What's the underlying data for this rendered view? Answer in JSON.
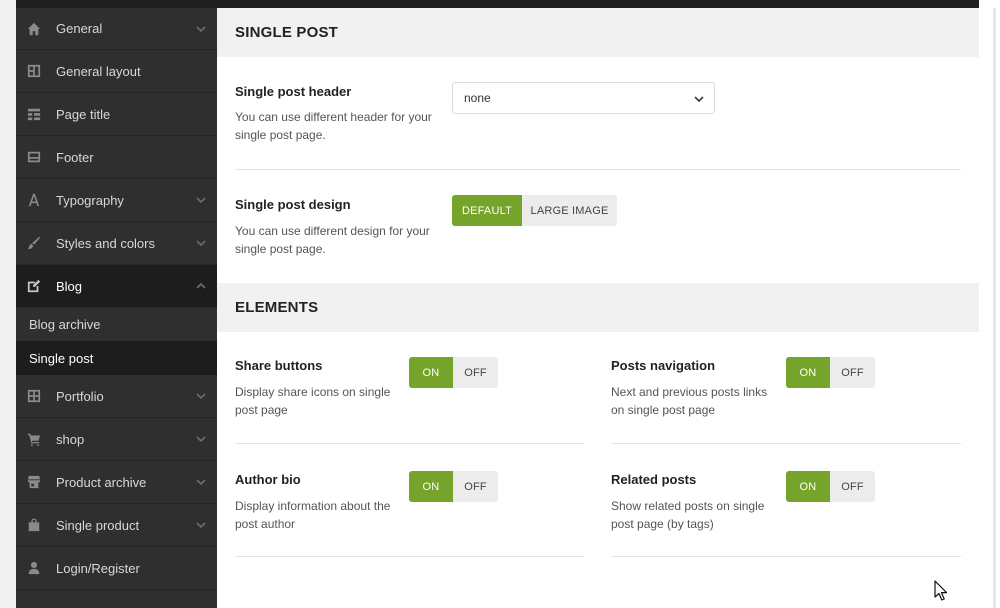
{
  "sidebar": {
    "items": [
      {
        "label": "General",
        "icon": "home-icon",
        "chevron": "down"
      },
      {
        "label": "General layout",
        "icon": "layout-icon",
        "chevron": ""
      },
      {
        "label": "Page title",
        "icon": "page-title-icon",
        "chevron": ""
      },
      {
        "label": "Footer",
        "icon": "footer-icon",
        "chevron": ""
      },
      {
        "label": "Typography",
        "icon": "typography-icon",
        "chevron": "down"
      },
      {
        "label": "Styles and colors",
        "icon": "brush-icon",
        "chevron": "down"
      },
      {
        "label": "Blog",
        "icon": "edit-icon",
        "chevron": "up"
      },
      {
        "label": "Portfolio",
        "icon": "grid-icon",
        "chevron": "down"
      },
      {
        "label": "shop",
        "icon": "cart-icon",
        "chevron": "down"
      },
      {
        "label": "Product archive",
        "icon": "store-icon",
        "chevron": "down"
      },
      {
        "label": "Single product",
        "icon": "bag-icon",
        "chevron": "down"
      },
      {
        "label": "Login/Register",
        "icon": "user-icon",
        "chevron": ""
      }
    ],
    "blog_sub": [
      "Blog archive",
      "Single post"
    ]
  },
  "single_post": {
    "heading": "SINGLE POST",
    "header": {
      "title": "Single post header",
      "desc_1": "You can use different header for your",
      "desc_2": "single post page.",
      "value": "none"
    },
    "design": {
      "title": "Single post design",
      "desc_1": "You can use different design for your",
      "desc_2": "single post page.",
      "options": [
        "DEFAULT",
        "LARGE IMAGE"
      ],
      "selected": "DEFAULT"
    }
  },
  "elements": {
    "heading": "ELEMENTS",
    "on_label": "ON",
    "off_label": "OFF",
    "share": {
      "title": "Share buttons",
      "desc_1": "Display share icons on single",
      "desc_2": "post page",
      "state": "ON"
    },
    "nav": {
      "title": "Posts navigation",
      "desc_1": "Next and previous posts links",
      "desc_2": "on single post page",
      "state": "ON"
    },
    "author": {
      "title": "Author bio",
      "desc_1": "Display information about the",
      "desc_2": "post author",
      "state": "ON"
    },
    "related": {
      "title": "Related posts",
      "desc_1": "Show related posts on single",
      "desc_2": "post page (by tags)",
      "state": "ON"
    }
  },
  "colors": {
    "accent": "#76a32a",
    "sidebar_bg": "#2f2f2f",
    "sidebar_active": "#1d1d1d"
  }
}
